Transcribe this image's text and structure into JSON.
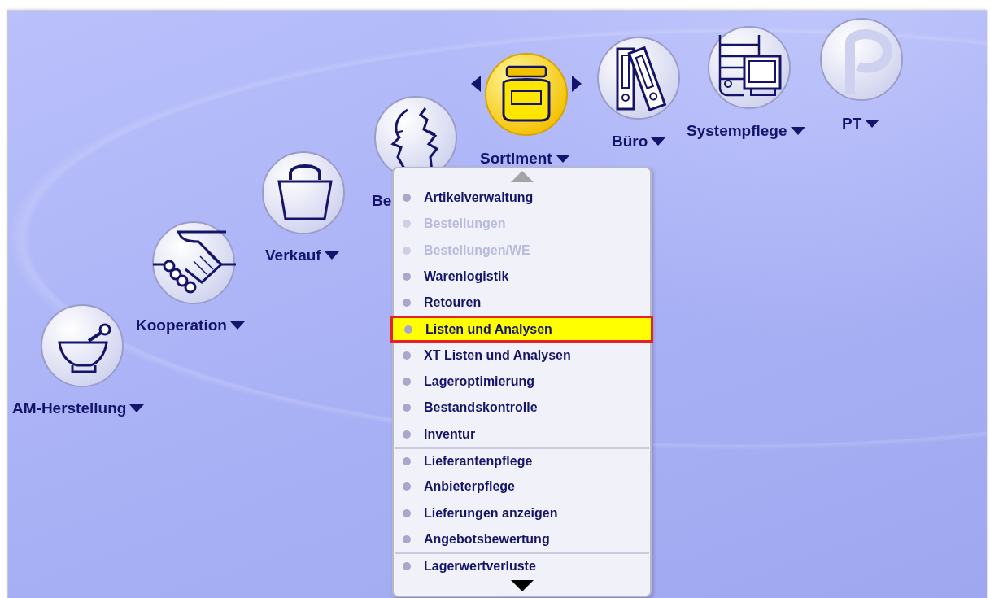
{
  "launcher": [
    {
      "label": "AM-Herstellung",
      "kind": "mortar",
      "selected": false
    },
    {
      "label": "Kooperation",
      "kind": "handshake",
      "selected": false
    },
    {
      "label": "Verkauf",
      "kind": "bag",
      "selected": false
    },
    {
      "label": "Be",
      "kind": "faces",
      "selected": false
    },
    {
      "label": "Sortiment",
      "kind": "jar",
      "selected": true
    },
    {
      "label": "Büro",
      "kind": "binders",
      "selected": false
    },
    {
      "label": "Systempflege",
      "kind": "computer",
      "selected": false
    },
    {
      "label": "PT",
      "kind": "logo",
      "selected": false
    }
  ],
  "menu": {
    "can_scroll_up": false,
    "can_scroll_down": true,
    "items": [
      {
        "label": "Artikelverwaltung",
        "disabled": false,
        "selected": false,
        "separator_before": false
      },
      {
        "label": "Bestellungen",
        "disabled": true,
        "selected": false,
        "separator_before": false
      },
      {
        "label": "Bestellungen/WE",
        "disabled": true,
        "selected": false,
        "separator_before": false
      },
      {
        "label": "Warenlogistik",
        "disabled": false,
        "selected": false,
        "separator_before": false
      },
      {
        "label": "Retouren",
        "disabled": false,
        "selected": false,
        "separator_before": false
      },
      {
        "label": "Listen und Analysen",
        "disabled": false,
        "selected": true,
        "separator_before": false
      },
      {
        "label": "XT Listen und Analysen",
        "disabled": false,
        "selected": false,
        "separator_before": false
      },
      {
        "label": "Lageroptimierung",
        "disabled": false,
        "selected": false,
        "separator_before": false
      },
      {
        "label": "Bestandskontrolle",
        "disabled": false,
        "selected": false,
        "separator_before": false
      },
      {
        "label": "Inventur",
        "disabled": false,
        "selected": false,
        "separator_before": false
      },
      {
        "label": "Lieferantenpflege",
        "disabled": false,
        "selected": false,
        "separator_before": true
      },
      {
        "label": "Anbieterpflege",
        "disabled": false,
        "selected": false,
        "separator_before": false
      },
      {
        "label": "Lieferungen anzeigen",
        "disabled": false,
        "selected": false,
        "separator_before": false
      },
      {
        "label": "Angebotsbewertung",
        "disabled": false,
        "selected": false,
        "separator_before": false
      },
      {
        "label": "Lagerwertverluste",
        "disabled": false,
        "selected": false,
        "separator_before": true
      }
    ]
  }
}
